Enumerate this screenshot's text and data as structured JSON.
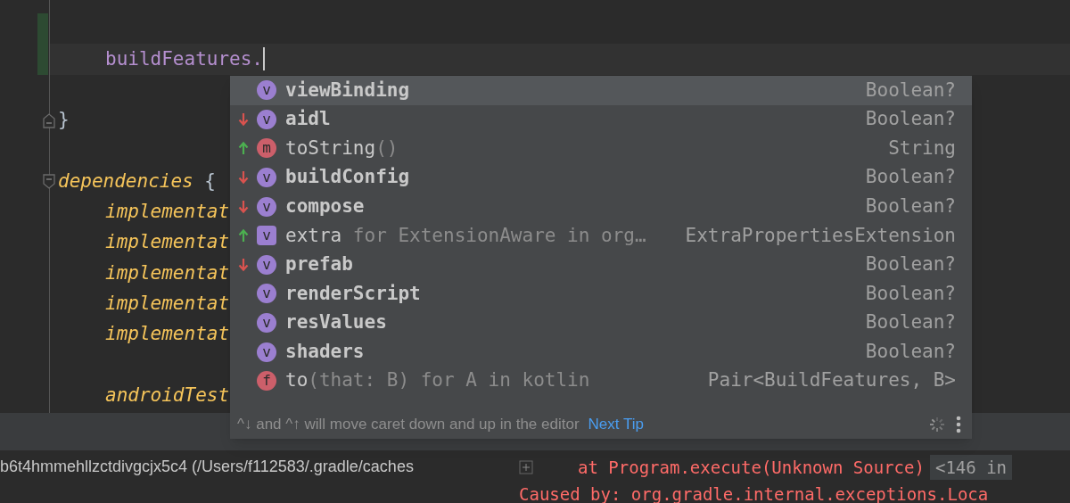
{
  "editor": {
    "lines": [
      {
        "changed": true,
        "current": false,
        "fold_start": false,
        "fold_end": false
      },
      {
        "changed": true,
        "current": true,
        "fold_start": false,
        "fold_end": false,
        "indented": true,
        "segments": [
          {
            "kind": "property",
            "text": "buildFeatures."
          }
        ]
      },
      {
        "changed": false,
        "current": false,
        "fold_start": false,
        "fold_end": false
      },
      {
        "changed": false,
        "current": false,
        "fold_start": false,
        "fold_end": true,
        "indented": false,
        "segments": [
          {
            "kind": "brace",
            "text": "}"
          }
        ]
      },
      {
        "changed": false,
        "current": false,
        "fold_start": false,
        "fold_end": false
      },
      {
        "changed": false,
        "current": false,
        "fold_start": true,
        "fold_end": false,
        "indented": false,
        "segments": [
          {
            "kind": "function",
            "text": "dependencies"
          },
          {
            "kind": "brace",
            "text": " {"
          }
        ]
      },
      {
        "changed": false,
        "current": false,
        "fold_start": false,
        "fold_end": false,
        "indented": true,
        "segments": [
          {
            "kind": "function",
            "text": "implementat"
          }
        ]
      },
      {
        "changed": false,
        "current": false,
        "fold_start": false,
        "fold_end": false,
        "indented": true,
        "segments": [
          {
            "kind": "function",
            "text": "implementat"
          }
        ]
      },
      {
        "changed": false,
        "current": false,
        "fold_start": false,
        "fold_end": false,
        "indented": true,
        "segments": [
          {
            "kind": "function",
            "text": "implementat"
          }
        ]
      },
      {
        "changed": false,
        "current": false,
        "fold_start": false,
        "fold_end": false,
        "indented": true,
        "segments": [
          {
            "kind": "function",
            "text": "implementat"
          }
        ]
      },
      {
        "changed": false,
        "current": false,
        "fold_start": false,
        "fold_end": false,
        "indented": true,
        "segments": [
          {
            "kind": "function",
            "text": "implementat"
          }
        ]
      },
      {
        "changed": false,
        "current": false,
        "fold_start": false,
        "fold_end": false
      },
      {
        "changed": false,
        "current": false,
        "fold_start": false,
        "fold_end": false,
        "indented": true,
        "segments": [
          {
            "kind": "function",
            "text": "androidTest"
          }
        ]
      }
    ]
  },
  "completion": {
    "items": [
      {
        "selected": true,
        "moved_down": false,
        "moved_up": false,
        "icon": {
          "letter": "v",
          "square": false,
          "color": "#9b7fd0"
        },
        "name": "viewBinding",
        "bold": true,
        "type": "Boolean?"
      },
      {
        "selected": false,
        "moved_down": true,
        "moved_up": false,
        "icon": {
          "letter": "v",
          "square": false,
          "color": "#9b7fd0"
        },
        "name": "aidl",
        "bold": true,
        "type": "Boolean?"
      },
      {
        "selected": false,
        "moved_down": false,
        "moved_up": true,
        "icon": {
          "letter": "m",
          "square": false,
          "color": "#cc5f6a"
        },
        "name": "toString",
        "bold": false,
        "detail": "()",
        "type": "String"
      },
      {
        "selected": false,
        "moved_down": true,
        "moved_up": false,
        "icon": {
          "letter": "v",
          "square": false,
          "color": "#9b7fd0"
        },
        "name": "buildConfig",
        "bold": true,
        "type": "Boolean?"
      },
      {
        "selected": false,
        "moved_down": true,
        "moved_up": false,
        "icon": {
          "letter": "v",
          "square": false,
          "color": "#9b7fd0"
        },
        "name": "compose",
        "bold": true,
        "type": "Boolean?"
      },
      {
        "selected": false,
        "moved_down": false,
        "moved_up": true,
        "icon": {
          "letter": "v",
          "square": true,
          "color": "#9b7fd0"
        },
        "name": "extra",
        "bold": false,
        "detail": " for ExtensionAware in org…",
        "type": "ExtraPropertiesExtension"
      },
      {
        "selected": false,
        "moved_down": true,
        "moved_up": false,
        "icon": {
          "letter": "v",
          "square": false,
          "color": "#9b7fd0"
        },
        "name": "prefab",
        "bold": true,
        "type": "Boolean?"
      },
      {
        "selected": false,
        "moved_down": false,
        "moved_up": false,
        "icon": {
          "letter": "v",
          "square": false,
          "color": "#9b7fd0"
        },
        "name": "renderScript",
        "bold": true,
        "type": "Boolean?"
      },
      {
        "selected": false,
        "moved_down": false,
        "moved_up": false,
        "icon": {
          "letter": "v",
          "square": false,
          "color": "#9b7fd0"
        },
        "name": "resValues",
        "bold": true,
        "type": "Boolean?"
      },
      {
        "selected": false,
        "moved_down": false,
        "moved_up": false,
        "icon": {
          "letter": "v",
          "square": false,
          "color": "#9b7fd0"
        },
        "name": "shaders",
        "bold": true,
        "type": "Boolean?"
      },
      {
        "selected": false,
        "moved_down": false,
        "moved_up": false,
        "icon": {
          "letter": "f",
          "square": false,
          "color": "#cc5f6a"
        },
        "name": "to",
        "bold": false,
        "detail": "(that: B) for A in kotlin",
        "type": "Pair<BuildFeatures, B>"
      }
    ],
    "hint": "^↓ and ^↑ will move caret down and up in the editor",
    "hint_link": "Next Tip"
  },
  "console": {
    "path": "b6t4hmmehllzctdivgcjx5c4 (/Users/f112583/.gradle/caches",
    "lines": [
      {
        "text": "at Program.execute(Unknown Source)",
        "folded": "<146 in"
      },
      {
        "text": "Caused by: org.gradle.internal.exceptions.Loca"
      }
    ]
  }
}
